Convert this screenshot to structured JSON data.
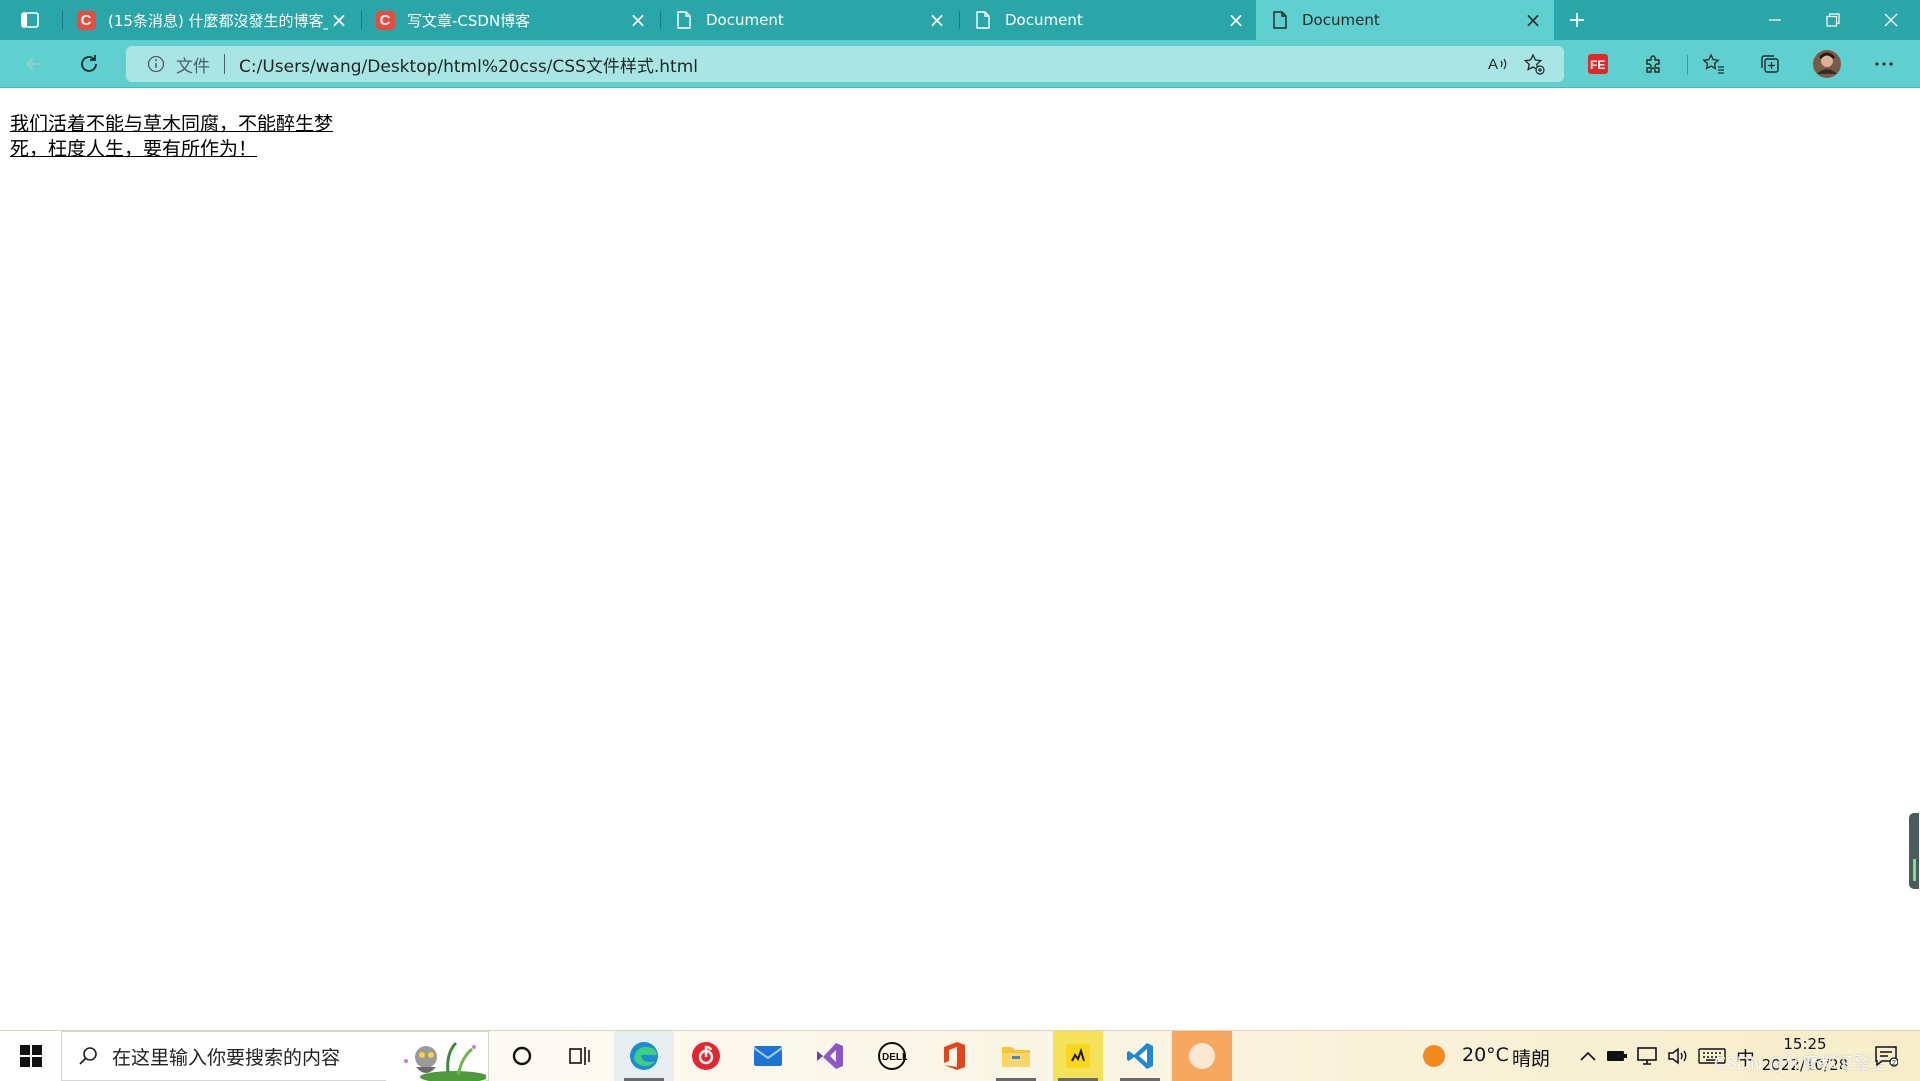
{
  "browser": {
    "tabs": [
      {
        "title": "(15条消息) 什麼都沒發生的博客_",
        "icon": "csdn-icon",
        "active": false
      },
      {
        "title": "写文章-CSDN博客",
        "icon": "csdn-icon",
        "active": false
      },
      {
        "title": "Document",
        "icon": "page-icon",
        "active": false
      },
      {
        "title": "Document",
        "icon": "page-icon",
        "active": false
      },
      {
        "title": "Document",
        "icon": "page-icon",
        "active": true
      }
    ],
    "close_glyph": "×",
    "address": {
      "scheme_label": "文件",
      "url": "C:/Users/wang/Desktop/html%20css/CSS文件样式.html"
    },
    "colors": {
      "tabstrip": "#2aa6a8",
      "active_tab": "#5fd0cf",
      "toolbar": "#5fd0cf",
      "addressbar": "#a9e5e4"
    }
  },
  "page": {
    "text": "我们活着不能与草木同腐，不能醉生梦死，枉度人生，要有所作为！"
  },
  "taskbar": {
    "search_placeholder": "在这里输入你要搜索的内容",
    "weather": {
      "temperature": "20°C",
      "condition": "晴朗"
    },
    "ime": "中",
    "time": "15:25",
    "date": "2022/10/28",
    "watermark": "CSDN @什麼都沒發生"
  }
}
